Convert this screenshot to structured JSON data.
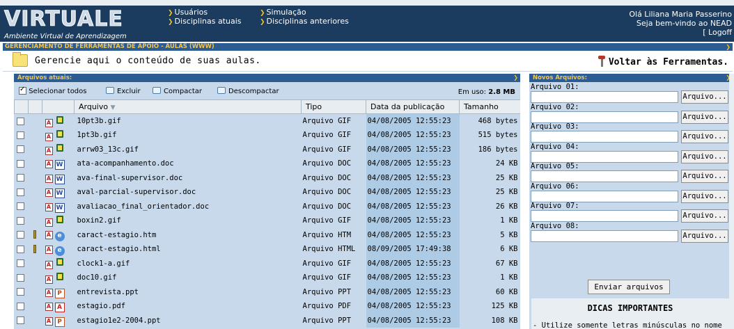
{
  "header": {
    "logo_title": "VIRTUALE",
    "logo_subtitle": "Ambiente Virtual de Aprendizagem",
    "nav": {
      "usuarios": "Usuários",
      "disciplinas_atuais": "Disciplinas atuais",
      "simulacao": "Simulação",
      "disciplinas_anteriores": "Disciplinas anteriores"
    },
    "greeting_line1": "Olá Liliana Maria Passerino",
    "greeting_line2": "Seja bem-vindo ao NEAD",
    "logoff": "[ Logoff"
  },
  "page_title": "GERENCIAMENTO DE FERRAMENTAS DE APOIO - AULAS (WWW)",
  "subtitle": "Gerencie aqui o conteúdo de suas aulas.",
  "back_link": "Voltar às Ferramentas.",
  "current_files": {
    "section_title": "Arquivos atuais:",
    "toolbar": {
      "select_all": "Selecionar todos",
      "delete": "Excluir",
      "compress": "Compactar",
      "decompress": "Descompactar",
      "usage_label": "Em uso:",
      "usage_value": "2.8 MB"
    },
    "columns": {
      "name": "Arquivo",
      "type": "Tipo",
      "date": "Data da publicação",
      "size": "Tamanho"
    },
    "files": [
      {
        "name": "10pt3b.gif",
        "type": "Arquivo GIF",
        "date": "04/08/2005 12:55:23",
        "size": "468 bytes",
        "icon": "gif",
        "pinned": false
      },
      {
        "name": "1pt3b.gif",
        "type": "Arquivo GIF",
        "date": "04/08/2005 12:55:23",
        "size": "515 bytes",
        "icon": "gif",
        "pinned": false
      },
      {
        "name": "arrw03_13c.gif",
        "type": "Arquivo GIF",
        "date": "04/08/2005 12:55:23",
        "size": "186 bytes",
        "icon": "gif",
        "pinned": false
      },
      {
        "name": "ata-acompanhamento.doc",
        "type": "Arquivo DOC",
        "date": "04/08/2005 12:55:23",
        "size": "24 KB",
        "icon": "doc",
        "pinned": false
      },
      {
        "name": "ava-final-supervisor.doc",
        "type": "Arquivo DOC",
        "date": "04/08/2005 12:55:23",
        "size": "25 KB",
        "icon": "doc",
        "pinned": false
      },
      {
        "name": "aval-parcial-supervisor.doc",
        "type": "Arquivo DOC",
        "date": "04/08/2005 12:55:23",
        "size": "25 KB",
        "icon": "doc",
        "pinned": false
      },
      {
        "name": "avaliacao_final_orientador.doc",
        "type": "Arquivo DOC",
        "date": "04/08/2005 12:55:23",
        "size": "26 KB",
        "icon": "doc",
        "pinned": false
      },
      {
        "name": "boxin2.gif",
        "type": "Arquivo GIF",
        "date": "04/08/2005 12:55:23",
        "size": "1 KB",
        "icon": "gif",
        "pinned": false
      },
      {
        "name": "caract-estagio.htm",
        "type": "Arquivo HTM",
        "date": "04/08/2005 12:55:23",
        "size": "5 KB",
        "icon": "htm",
        "pinned": true
      },
      {
        "name": "caract-estagio.html",
        "type": "Arquivo HTML",
        "date": "08/09/2005 17:49:38",
        "size": "6 KB",
        "icon": "htm",
        "pinned": true
      },
      {
        "name": "clock1-a.gif",
        "type": "Arquivo GIF",
        "date": "04/08/2005 12:55:23",
        "size": "67 KB",
        "icon": "gif",
        "pinned": false
      },
      {
        "name": "doc10.gif",
        "type": "Arquivo GIF",
        "date": "04/08/2005 12:55:23",
        "size": "1 KB",
        "icon": "gif",
        "pinned": false
      },
      {
        "name": "entrevista.ppt",
        "type": "Arquivo PPT",
        "date": "04/08/2005 12:55:23",
        "size": "60 KB",
        "icon": "ppt",
        "pinned": false
      },
      {
        "name": "estagio.pdf",
        "type": "Arquivo PDF",
        "date": "04/08/2005 12:55:23",
        "size": "125 KB",
        "icon": "pdf",
        "pinned": false
      },
      {
        "name": "estagio1e2-2004.ppt",
        "type": "Arquivo PPT",
        "date": "04/08/2005 12:55:23",
        "size": "108 KB",
        "icon": "ppt",
        "pinned": false
      }
    ]
  },
  "new_files": {
    "section_title": "Novos Arquivos:",
    "browse_label": "Arquivo...",
    "slots": [
      "Arquivo 01:",
      "Arquivo 02:",
      "Arquivo 03:",
      "Arquivo 04:",
      "Arquivo 05:",
      "Arquivo 06:",
      "Arquivo 07:",
      "Arquivo 08:"
    ],
    "send_button": "Enviar arquivos",
    "tips_title": "DICAS IMPORTANTES",
    "tips_text": "- Utilize somente letras minúsculas no nome"
  },
  "colors": {
    "header_bg": "#1b3c5e",
    "section_bar": "#2d5c92",
    "section_text": "#f5c64b",
    "panel_bg": "#c7d9ea",
    "date_column_bg": "#aecbe5"
  }
}
